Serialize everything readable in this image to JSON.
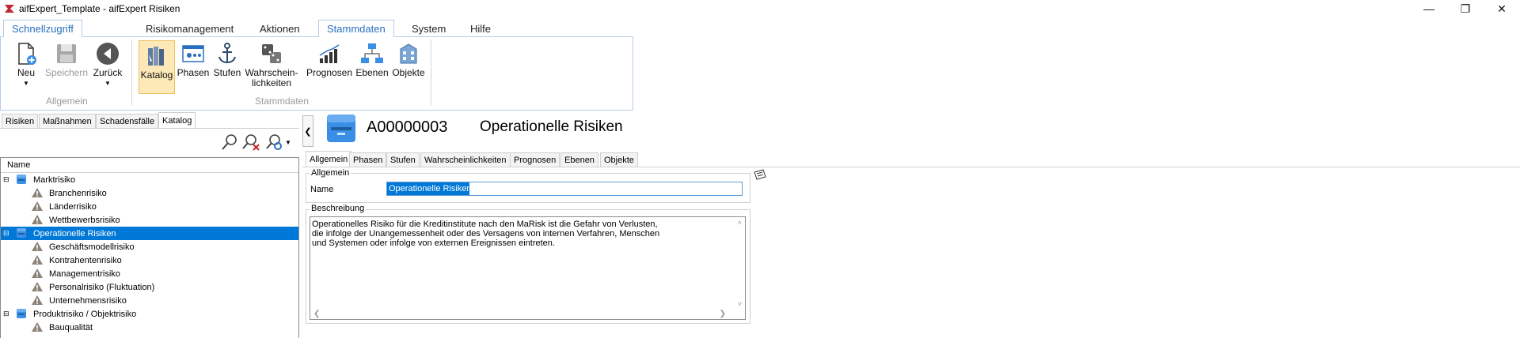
{
  "window": {
    "title": "aifExpert_Template - aifExpert Risiken"
  },
  "ribbon": {
    "tabs": [
      "Schnellzugriff",
      "Risikomanagement",
      "Aktionen",
      "Stammdaten",
      "System",
      "Hilfe"
    ],
    "active_tab": "Stammdaten",
    "groups": {
      "allgemein": {
        "label": "Allgemein",
        "buttons": {
          "new": "Neu",
          "save": "Speichern",
          "back": "Zurück"
        }
      },
      "stammdaten": {
        "label": "Stammdaten",
        "buttons": {
          "katalog": "Katalog",
          "phasen": "Phasen",
          "stufen": "Stufen",
          "wahrscheinlichkeiten": "Wahrschein-\nlichkeiten",
          "prognosen": "Prognosen",
          "ebenen": "Ebenen",
          "objekte": "Objekte"
        }
      }
    }
  },
  "left": {
    "tabs": [
      "Risiken",
      "Maßnahmen",
      "Schadensfälle",
      "Katalog"
    ],
    "active_tab": "Katalog",
    "tree_header": "Name",
    "tree": [
      {
        "label": "Marktrisiko",
        "level": 0,
        "type": "category"
      },
      {
        "label": "Branchenrisiko",
        "level": 1,
        "type": "risk"
      },
      {
        "label": "Länderrisiko",
        "level": 1,
        "type": "risk"
      },
      {
        "label": "Wettbewerbsrisiko",
        "level": 1,
        "type": "risk"
      },
      {
        "label": "Operationelle Risiken",
        "level": 0,
        "type": "category",
        "selected": true
      },
      {
        "label": "Geschäftsmodellrisiko",
        "level": 1,
        "type": "risk"
      },
      {
        "label": "Kontrahentenrisiko",
        "level": 1,
        "type": "risk"
      },
      {
        "label": "Managementrisiko",
        "level": 1,
        "type": "risk"
      },
      {
        "label": "Personalrisiko (Fluktuation)",
        "level": 1,
        "type": "risk"
      },
      {
        "label": "Unternehmensrisiko",
        "level": 1,
        "type": "risk"
      },
      {
        "label": "Produktrisiko / Objektrisiko",
        "level": 0,
        "type": "category"
      },
      {
        "label": "Bauqualität",
        "level": 1,
        "type": "risk"
      }
    ]
  },
  "detail": {
    "id": "A00000003",
    "name": "Operationelle Risiken",
    "tabs": [
      "Allgemein",
      "Phasen",
      "Stufen",
      "Wahrscheinlichkeiten",
      "Prognosen",
      "Ebenen",
      "Objekte"
    ],
    "active_tab": "Allgemein",
    "group_allgemein": "Allgemein",
    "name_label": "Name",
    "name_value": "Operationelle Risiken",
    "group_beschreibung": "Beschreibung",
    "description": "Operationelles Risiko für die Kreditinstitute nach den MaRisk ist die Gefahr von Verlusten,\ndie infolge der Unangemessenheit oder des Versagens von internen Verfahren, Menschen\nund Systemen oder infolge von externen Ereignissen eintreten."
  },
  "colors": {
    "selection": "#0078d7",
    "ribbon_active": "#2a6fbf",
    "warning_icon": "#8c8278"
  }
}
